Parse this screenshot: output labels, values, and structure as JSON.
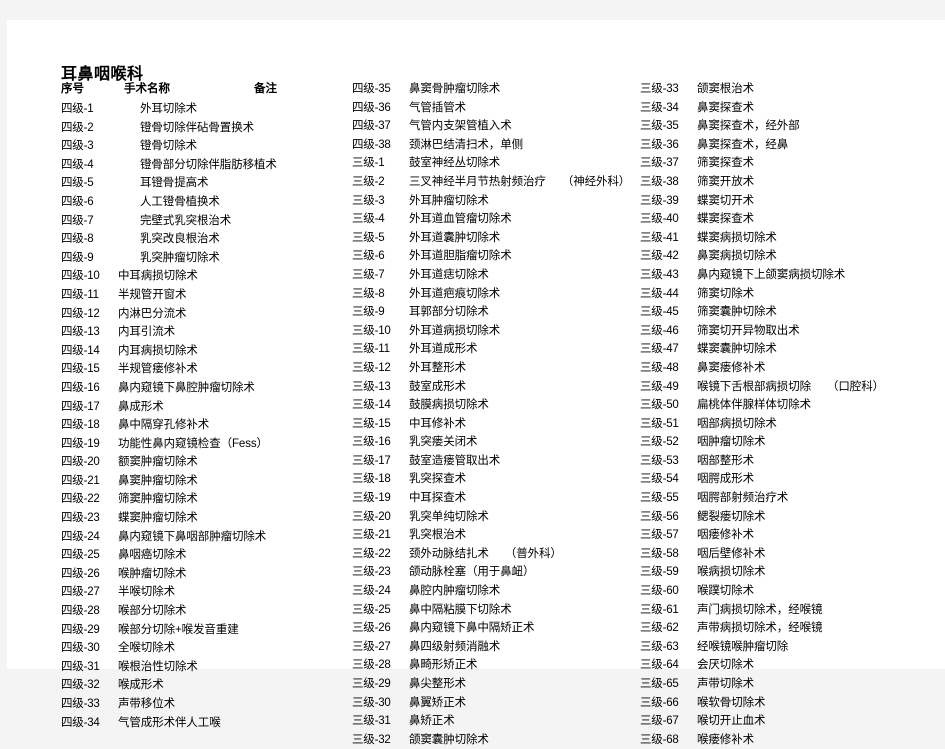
{
  "document": {
    "title": "耳鼻咽喉科",
    "headers": {
      "no": "序号",
      "name": "手术名称",
      "note": "备注"
    }
  },
  "columns": [
    {
      "id": "column-1",
      "rows": [
        {
          "no": "四级-1",
          "name": "外耳切除术",
          "note": "",
          "indent": true
        },
        {
          "no": "四级-2",
          "name": "镫骨切除伴砧骨置换术",
          "note": "",
          "indent": true
        },
        {
          "no": "四级-3",
          "name": "镫骨切除术",
          "note": "",
          "indent": true
        },
        {
          "no": "四级-4",
          "name": "镫骨部分切除伴脂肪移植术",
          "note": "",
          "indent": true
        },
        {
          "no": "四级-5",
          "name": "耳镫骨提高术",
          "note": "",
          "indent": true
        },
        {
          "no": "四级-6",
          "name": "人工镫骨植换术",
          "note": "",
          "indent": true
        },
        {
          "no": "四级-7",
          "name": "完壁式乳突根治术",
          "note": "",
          "indent": true
        },
        {
          "no": "四级-8",
          "name": "乳突改良根治术",
          "note": "",
          "indent": true
        },
        {
          "no": "四级-9",
          "name": "乳突肿瘤切除术",
          "note": "",
          "indent": true
        },
        {
          "no": "四级-10",
          "name": "中耳病损切除术",
          "note": "",
          "indent": false
        },
        {
          "no": "四级-11",
          "name": "半规管开窗术",
          "note": "",
          "indent": false
        },
        {
          "no": "四级-12",
          "name": "内淋巴分流术",
          "note": "",
          "indent": false
        },
        {
          "no": "四级-13",
          "name": "内耳引流术",
          "note": "",
          "indent": false
        },
        {
          "no": "四级-14",
          "name": "内耳病损切除术",
          "note": "",
          "indent": false
        },
        {
          "no": "四级-15",
          "name": "半规管瘘修补术",
          "note": "",
          "indent": false
        },
        {
          "no": "四级-16",
          "name": "鼻内窥镜下鼻腔肿瘤切除术",
          "note": "",
          "indent": false
        },
        {
          "no": "四级-17",
          "name": "鼻成形术",
          "note": "",
          "indent": false
        },
        {
          "no": "四级-18",
          "name": "鼻中隔穿孔修补术",
          "note": "",
          "indent": false
        },
        {
          "no": "四级-19",
          "name": "功能性鼻内窥镜检查（Fess）",
          "note": "",
          "indent": false
        },
        {
          "no": "四级-20",
          "name": "额窦肿瘤切除术",
          "note": "",
          "indent": false
        },
        {
          "no": "四级-21",
          "name": "鼻窦肿瘤切除术",
          "note": "",
          "indent": false
        },
        {
          "no": "四级-22",
          "name": "筛窦肿瘤切除术",
          "note": "",
          "indent": false
        },
        {
          "no": "四级-23",
          "name": "蝶窦肿瘤切除术",
          "note": "",
          "indent": false
        },
        {
          "no": "四级-24",
          "name": "鼻内窥镜下鼻咽部肿瘤切除术",
          "note": "",
          "indent": false
        },
        {
          "no": "四级-25",
          "name": "鼻咽癌切除术",
          "note": "",
          "indent": false
        },
        {
          "no": "四级-26",
          "name": "喉肿瘤切除术",
          "note": "",
          "indent": false
        },
        {
          "no": "四级-27",
          "name": "半喉切除术",
          "note": "",
          "indent": false
        },
        {
          "no": "四级-28",
          "name": "喉部分切除术",
          "note": "",
          "indent": false
        },
        {
          "no": "四级-29",
          "name": "喉部分切除+喉发音重建",
          "note": "",
          "indent": false
        },
        {
          "no": "四级-30",
          "name": "全喉切除术",
          "note": "",
          "indent": false
        },
        {
          "no": "四级-31",
          "name": "喉根治性切除术",
          "note": "",
          "indent": false
        },
        {
          "no": "四级-32",
          "name": "喉成形术",
          "note": "",
          "indent": false
        },
        {
          "no": "四级-33",
          "name": "声带移位术",
          "note": "",
          "indent": false
        },
        {
          "no": "四级-34",
          "name": "气管成形术伴人工喉",
          "note": "",
          "indent": false
        }
      ]
    },
    {
      "id": "column-2",
      "rows": [
        {
          "no": "四级-35",
          "name": "鼻窦骨肿瘤切除术",
          "note": "",
          "indent": false
        },
        {
          "no": "四级-36",
          "name": "气管插管术",
          "note": "",
          "indent": false
        },
        {
          "no": "四级-37",
          "name": "气管内支架管植入术",
          "note": "",
          "indent": false
        },
        {
          "no": "四级-38",
          "name": "颈淋巴结清扫术，单侧",
          "note": "",
          "indent": false
        },
        {
          "no": "三级-1",
          "name": "鼓室神经丛切除术",
          "note": "",
          "indent": false
        },
        {
          "no": "三级-2",
          "name": "三叉神经半月节热射频治疗",
          "note": "（神经外科）",
          "indent": false
        },
        {
          "no": "三级-3",
          "name": "外耳肿瘤切除术",
          "note": "",
          "indent": false
        },
        {
          "no": "三级-4",
          "name": "外耳道血管瘤切除术",
          "note": "",
          "indent": false
        },
        {
          "no": "三级-5",
          "name": "外耳道囊肿切除术",
          "note": "",
          "indent": false
        },
        {
          "no": "三级-6",
          "name": "外耳道胆脂瘤切除术",
          "note": "",
          "indent": false
        },
        {
          "no": "三级-7",
          "name": "外耳道痣切除术",
          "note": "",
          "indent": false
        },
        {
          "no": "三级-8",
          "name": "外耳道疤痕切除术",
          "note": "",
          "indent": false
        },
        {
          "no": "三级-9",
          "name": "耳郭部分切除术",
          "note": "",
          "indent": false
        },
        {
          "no": "三级-10",
          "name": "外耳道病损切除术",
          "note": "",
          "indent": false
        },
        {
          "no": "三级-11",
          "name": "外耳道成形术",
          "note": "",
          "indent": false
        },
        {
          "no": "三级-12",
          "name": "外耳整形术",
          "note": "",
          "indent": false
        },
        {
          "no": "三级-13",
          "name": "鼓室成形术",
          "note": "",
          "indent": false
        },
        {
          "no": "三级-14",
          "name": "鼓膜病损切除术",
          "note": "",
          "indent": false
        },
        {
          "no": "三级-15",
          "name": "中耳修补术",
          "note": "",
          "indent": false
        },
        {
          "no": "三级-16",
          "name": "乳突瘘关闭术",
          "note": "",
          "indent": false
        },
        {
          "no": "三级-17",
          "name": "鼓室造瘘管取出术",
          "note": "",
          "indent": false
        },
        {
          "no": "三级-18",
          "name": "乳突探查术",
          "note": "",
          "indent": false
        },
        {
          "no": "三级-19",
          "name": "中耳探查术",
          "note": "",
          "indent": false
        },
        {
          "no": "三级-20",
          "name": "乳突单纯切除术",
          "note": "",
          "indent": false
        },
        {
          "no": "三级-21",
          "name": "乳突根治术",
          "note": "",
          "indent": false
        },
        {
          "no": "三级-22",
          "name": "颈外动脉结扎术",
          "note": "（普外科）",
          "indent": false
        },
        {
          "no": "三级-23",
          "name": "颌动脉栓塞（用于鼻衄）",
          "note": "",
          "indent": false
        },
        {
          "no": "三级-24",
          "name": "鼻腔内肿瘤切除术",
          "note": "",
          "indent": false
        },
        {
          "no": "三级-25",
          "name": "鼻中隔粘膜下切除术",
          "note": "",
          "indent": false
        },
        {
          "no": "三级-26",
          "name": "鼻内窥镜下鼻中隔矫正术",
          "note": "",
          "indent": false
        },
        {
          "no": "三级-27",
          "name": "鼻四级射频消融术",
          "note": "",
          "indent": false
        },
        {
          "no": "三级-28",
          "name": "鼻畸形矫正术",
          "note": "",
          "indent": false
        },
        {
          "no": "三级-29",
          "name": "鼻尖整形术",
          "note": "",
          "indent": false
        },
        {
          "no": "三级-30",
          "name": "鼻翼矫正术",
          "note": "",
          "indent": false
        },
        {
          "no": "三级-31",
          "name": "鼻矫正术",
          "note": "",
          "indent": false
        },
        {
          "no": "三级-32",
          "name": "颌窦囊肿切除术",
          "note": "",
          "indent": false
        }
      ]
    },
    {
      "id": "column-3",
      "rows": [
        {
          "no": "三级-33",
          "name": "颌窦根治术",
          "note": "",
          "indent": false
        },
        {
          "no": "三级-34",
          "name": "鼻窦探查术",
          "note": "",
          "indent": false
        },
        {
          "no": "三级-35",
          "name": "鼻窦探查术，经外部",
          "note": "",
          "indent": false
        },
        {
          "no": "三级-36",
          "name": "鼻窦探查术，经鼻",
          "note": "",
          "indent": false
        },
        {
          "no": "三级-37",
          "name": "筛窦探查术",
          "note": "",
          "indent": false
        },
        {
          "no": "三级-38",
          "name": "筛窦开放术",
          "note": "",
          "indent": false
        },
        {
          "no": "三级-39",
          "name": "蝶窦切开术",
          "note": "",
          "indent": false
        },
        {
          "no": "三级-40",
          "name": "蝶窦探查术",
          "note": "",
          "indent": false
        },
        {
          "no": "三级-41",
          "name": "蝶窦病损切除术",
          "note": "",
          "indent": false
        },
        {
          "no": "三级-42",
          "name": "鼻窦病损切除术",
          "note": "",
          "indent": false
        },
        {
          "no": "三级-43",
          "name": "鼻内窥镜下上颌窦病损切除术",
          "note": "",
          "indent": false
        },
        {
          "no": "三级-44",
          "name": "筛窦切除术",
          "note": "",
          "indent": false
        },
        {
          "no": "三级-45",
          "name": "筛窦囊肿切除术",
          "note": "",
          "indent": false
        },
        {
          "no": "三级-46",
          "name": "筛窦切开异物取出术",
          "note": "",
          "indent": false
        },
        {
          "no": "三级-47",
          "name": "蝶窦囊肿切除术",
          "note": "",
          "indent": false
        },
        {
          "no": "三级-48",
          "name": "鼻窦瘘修补术",
          "note": "",
          "indent": false
        },
        {
          "no": "三级-49",
          "name": "喉镜下舌根部病损切除",
          "note": "（口腔科）",
          "indent": false
        },
        {
          "no": "三级-50",
          "name": "扁桃体伴腺样体切除术",
          "note": "",
          "indent": false
        },
        {
          "no": "三级-51",
          "name": "咽部病损切除术",
          "note": "",
          "indent": false
        },
        {
          "no": "三级-52",
          "name": "咽肿瘤切除术",
          "note": "",
          "indent": false
        },
        {
          "no": "三级-53",
          "name": "咽部整形术",
          "note": "",
          "indent": false
        },
        {
          "no": "三级-54",
          "name": "咽腭成形术",
          "note": "",
          "indent": false
        },
        {
          "no": "三级-55",
          "name": "咽腭部射频治疗术",
          "note": "",
          "indent": false
        },
        {
          "no": "三级-56",
          "name": "鳃裂瘘切除术",
          "note": "",
          "indent": false
        },
        {
          "no": "三级-57",
          "name": "咽瘘修补术",
          "note": "",
          "indent": false
        },
        {
          "no": "三级-58",
          "name": "咽后壁修补术",
          "note": "",
          "indent": false
        },
        {
          "no": "三级-59",
          "name": "喉病损切除术",
          "note": "",
          "indent": false
        },
        {
          "no": "三级-60",
          "name": "喉蹼切除术",
          "note": "",
          "indent": false
        },
        {
          "no": "三级-61",
          "name": "声门病损切除术，经喉镜",
          "note": "",
          "indent": false
        },
        {
          "no": "三级-62",
          "name": "声带病损切除术，经喉镜",
          "note": "",
          "indent": false
        },
        {
          "no": "三级-63",
          "name": "经喉镜喉肿瘤切除",
          "note": "",
          "indent": false
        },
        {
          "no": "三级-64",
          "name": "会厌切除术",
          "note": "",
          "indent": false
        },
        {
          "no": "三级-65",
          "name": "声带切除术",
          "note": "",
          "indent": false
        },
        {
          "no": "三级-66",
          "name": "喉软骨切除术",
          "note": "",
          "indent": false
        },
        {
          "no": "三级-67",
          "name": "喉切开止血术",
          "note": "",
          "indent": false
        },
        {
          "no": "三级-68",
          "name": "喉瘘修补术",
          "note": "",
          "indent": false
        }
      ]
    }
  ]
}
